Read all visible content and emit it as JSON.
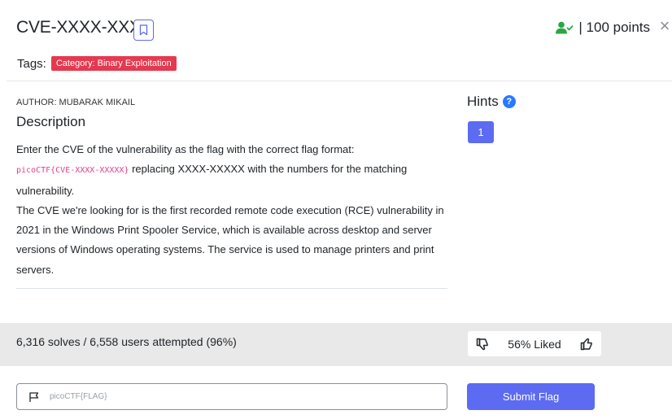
{
  "challenge": {
    "title": "CVE-XXXX-XXXX",
    "points": "| 100 points",
    "close_label": "×"
  },
  "tags": {
    "label": "Tags:",
    "items": [
      {
        "label": "Category: Binary Exploitation",
        "color": "#e53950"
      }
    ]
  },
  "description": {
    "author": "AUTHOR: MUBARAK MIKAIL",
    "heading": "Description",
    "line1": "Enter the CVE of the vulnerability as the flag with the correct flag format:",
    "code": "picoCTF{CVE-XXXX-XXXXX}",
    "line2": " replacing XXXX-XXXXX with the numbers for the matching vulnerability.",
    "line3": "The CVE we're looking for is the first recorded remote code execution (RCE) vulnerability in 2021 in the Windows Print Spooler Service, which is available across desktop and server versions of Windows operating systems. The service is used to manage printers and print servers."
  },
  "hints": {
    "heading": "Hints",
    "help_glyph": "?",
    "items": [
      {
        "label": "1"
      }
    ]
  },
  "stats": {
    "solves": "6,316 solves / 6,558 users attempted (96%)",
    "liked": "56% Liked"
  },
  "submit": {
    "placeholder": "picoCTF{FLAG}",
    "value": "",
    "button_label": "Submit Flag"
  },
  "colors": {
    "accent": "#5c6bf2",
    "tag_red": "#e53950",
    "success_green": "#28a745",
    "help_blue": "#2979ff"
  },
  "icons": {
    "bookmark": "bookmark-icon",
    "user_check": "user-check-icon",
    "close": "close-icon",
    "help": "help-icon",
    "thumbs_down": "thumbs-down-icon",
    "thumbs_up": "thumbs-up-icon",
    "flag": "flag-icon"
  }
}
